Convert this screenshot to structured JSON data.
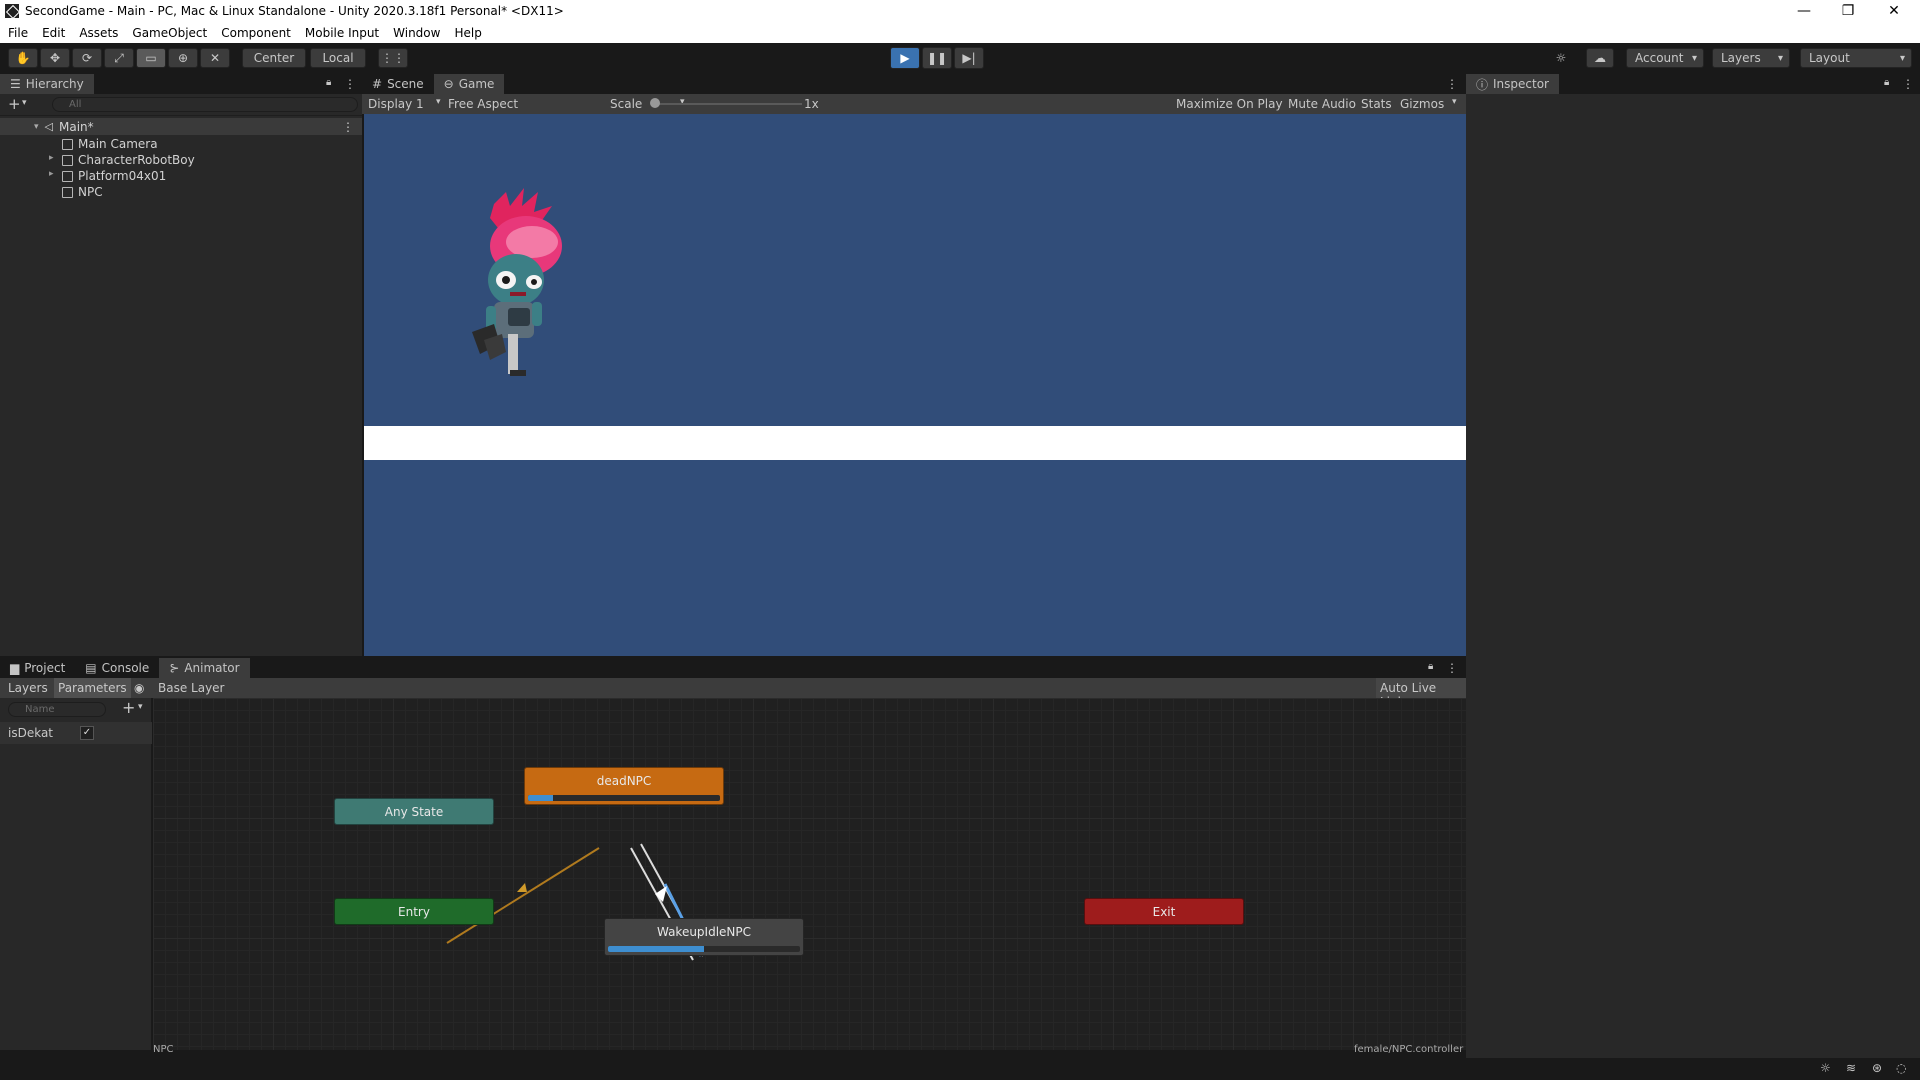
{
  "window": {
    "title": "SecondGame - Main - PC, Mac & Linux Standalone - Unity 2020.3.18f1 Personal* <DX11>",
    "controls": [
      "—",
      "❐",
      "✕"
    ]
  },
  "menu": [
    "File",
    "Edit",
    "Assets",
    "GameObject",
    "Component",
    "Mobile Input",
    "Window",
    "Help"
  ],
  "toolbar": {
    "tools": [
      "hand-tool-icon",
      "move-tool-icon",
      "rotate-tool-icon",
      "scale-tool-icon",
      "rect-tool-icon",
      "transform-tool-icon",
      "custom-tool-icon"
    ],
    "active_tool": "rect-tool-icon",
    "pivot_mode": "Center",
    "pivot_rotation": "Local",
    "play_active": true,
    "account": "Account",
    "layers": "Layers",
    "layout": "Layout"
  },
  "hierarchy": {
    "tab": "Hierarchy",
    "search_placeholder": "All",
    "scene": "Main*",
    "items": [
      "Main Camera",
      "CharacterRobotBoy",
      "Platform04x01",
      "NPC"
    ]
  },
  "views": {
    "tabs": [
      "Scene",
      "Game"
    ],
    "active_tab": "Game",
    "display": "Display 1",
    "aspect": "Free Aspect",
    "scale_label": "Scale",
    "scale_value": "1x",
    "options": [
      "Maximize On Play",
      "Mute Audio",
      "Stats",
      "Gizmos"
    ],
    "background_color": "#314d79"
  },
  "inspector": {
    "tab": "Inspector"
  },
  "bottom": {
    "tabs": [
      "Project",
      "Console",
      "Animator"
    ],
    "active_tab": "Animator",
    "sub_tabs": [
      "Layers",
      "Parameters"
    ],
    "active_sub_tab": "Parameters",
    "layer_breadcrumb": "Base Layer",
    "auto_live_link": "Auto Live Link",
    "name_placeholder": "Name",
    "parameters": [
      {
        "name": "isDekat",
        "value": true
      }
    ],
    "footer_left": "NPC",
    "footer_right": "female/NPC.controller"
  },
  "animator_states": {
    "any_state": {
      "label": "Any State",
      "color": "#3f7a73"
    },
    "entry": {
      "label": "Entry",
      "color": "#1f6b2a"
    },
    "exit": {
      "label": "Exit",
      "color": "#9e1c1c"
    },
    "dead": {
      "label": "deadNPC",
      "color": "#c66a12",
      "progress": 0.13
    },
    "wakeup": {
      "label": "WakeupIdleNPC",
      "color": "#444444",
      "progress": 0.5
    }
  }
}
